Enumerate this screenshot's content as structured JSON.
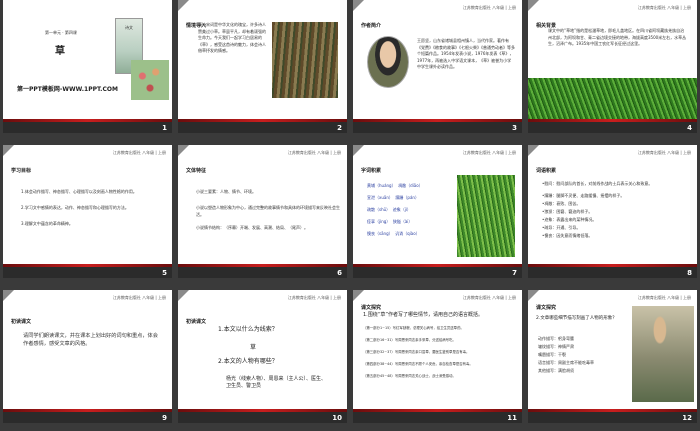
{
  "slides": [
    {
      "num": "1",
      "sub": "第一单元 · 第四课",
      "title": "草",
      "link": "第一PPT模板网-WWW.1PPT.COM",
      "book_title": "诗文"
    },
    {
      "num": "2",
      "section": "情境导入",
      "header": "",
      "body": "唐诗宋词是中华文化的瑰宝，许多诗人赞美过小草。草虽平凡，却有着顽强的生命力。今天我们一起学习白居易的《草》，感受这首诗的魅力，体会诗人借草抒发的情感。"
    },
    {
      "num": "3",
      "section": "作者简介",
      "header": "江苏教育出版社 八年级 | 上册",
      "body": "王愿坚，山东省诸城县相州镇人，当代作家。著作有《党费》《粮食的故事》《七根火柴》《普通劳动者》等多个短篇作品。1954年发表小说，1976年发表《草》，1977年，再被选入中学语文课本，《草》被誉为小学中学生课外必读作品。"
    },
    {
      "num": "4",
      "section": "相关背景",
      "header": "江苏教育出版社 八年级 | 上册",
      "body": "课文中的“草地”指的是松潘草地，即毛儿盖地区。在四川省阿坝藏族羌族自治州北部，为阿坝和甘、青二省边境交接的地带，海拔高度3500米左右，水草丛生，沼泽广布。1935年中国工农红军长征经过这里。"
    },
    {
      "num": "5",
      "section": "学习目标",
      "header": "江苏教育出版社 八年级 | 上册",
      "items": [
        "1.体会动作描写、神态描写、心理描写以及刻画人物性格的作用。",
        "2.学习文中感情的表达，动作、神态描写和心理描写的方法。",
        "3.理解文中蕴含的革命精神。"
      ]
    },
    {
      "num": "6",
      "section": "文体特征",
      "header": "江苏教育出版社 八年级 | 上册",
      "items": [
        "小说三要素：人物、情节、环境。",
        "小说以塑造人物形象为中心，通过完整的故事情节和具体的环境描写来反映社会生活。",
        "小说情节结构：（序幕）开端、发展、高潮、结局、（尾声）。"
      ]
    },
    {
      "num": "7",
      "section": "字词积累",
      "header": "江苏教育出版社 八年级 | 上册",
      "rows": [
        [
          "黄埔（huáng）",
          "凋敝（diāo）"
        ],
        [
          "宣泄（xuān）",
          "蹒跚（pán）"
        ],
        [
          "疏散（shū）",
          "迹象（jì）"
        ],
        [
          "痉挛（jìng）",
          "狭隘（ài）"
        ],
        [
          "懊丧（sāng）",
          "讥诮（qiào）"
        ]
      ]
    },
    {
      "num": "8",
      "section": "词语积累",
      "header": "江苏教育出版社 八年级 | 上册",
      "items": [
        "•慰问：慰问部队的首长，对前线作战的士兵表示关心和致意。",
        "•蹒跚：腿脚不灵便、走路缓慢、摇摆的样子。",
        "•凋敝：衰败、困苦。",
        "•狼狈：困窘、窘迫的样子。",
        "•迹象：表露出来的某种情况。",
        "•疏导：开通、引导。",
        "•懊丧：因失意而情绪低落。"
      ]
    },
    {
      "num": "9",
      "section": "初读课文",
      "header": "江苏教育出版社 八年级 | 上册",
      "body": "请同学们朗读课文，并在课本上划出好的词句和重点，体会作者感情，感受文章的风格。"
    },
    {
      "num": "10",
      "section": "初读课文",
      "header": "江苏教育出版社 八年级 | 上册",
      "q1": "1.本文以什么为线索？",
      "a1": "草",
      "q2": "2.本文的人物有哪些？",
      "a2": "杨光（线索人物）、周恩来（主人公）、医生、卫生员、警卫员"
    },
    {
      "num": "11",
      "section": "课文探究",
      "header": "江苏教育出版社 八年级 | 上册",
      "q": "1.围绕“草”作者写了哪些情节，请用自己的语言概括。",
      "items": [
        "（第一部分1~15）写红军缺粮，总理关心病号，给卫生员送草药。",
        "（第二部分16~31）写周恩来同志亲手采草，分送给病号吃。",
        "（第三部分32~37）写周恩来同志亲口尝草，要医生鉴别草是否有毒。",
        "（第四部分38~44）写周恩来同志不顾个人安危，亲自检查草是否有毒。",
        "（第五部分45~48）写周恩来同志关心战士，战士深受感动。"
      ]
    },
    {
      "num": "12",
      "section": "课文探究",
      "header": "江苏教育出版社 八年级 | 上册",
      "q": "2.文章哪些细节描写刻画了人物的形象？",
      "items": [
        "动作描写：躬身弯腰",
        "皱纹描写：神情严肃",
        "嘴唇描写：干裂",
        "语言描写：周副主席不能吃毒草",
        "其他描写：满脸胡须"
      ]
    }
  ]
}
